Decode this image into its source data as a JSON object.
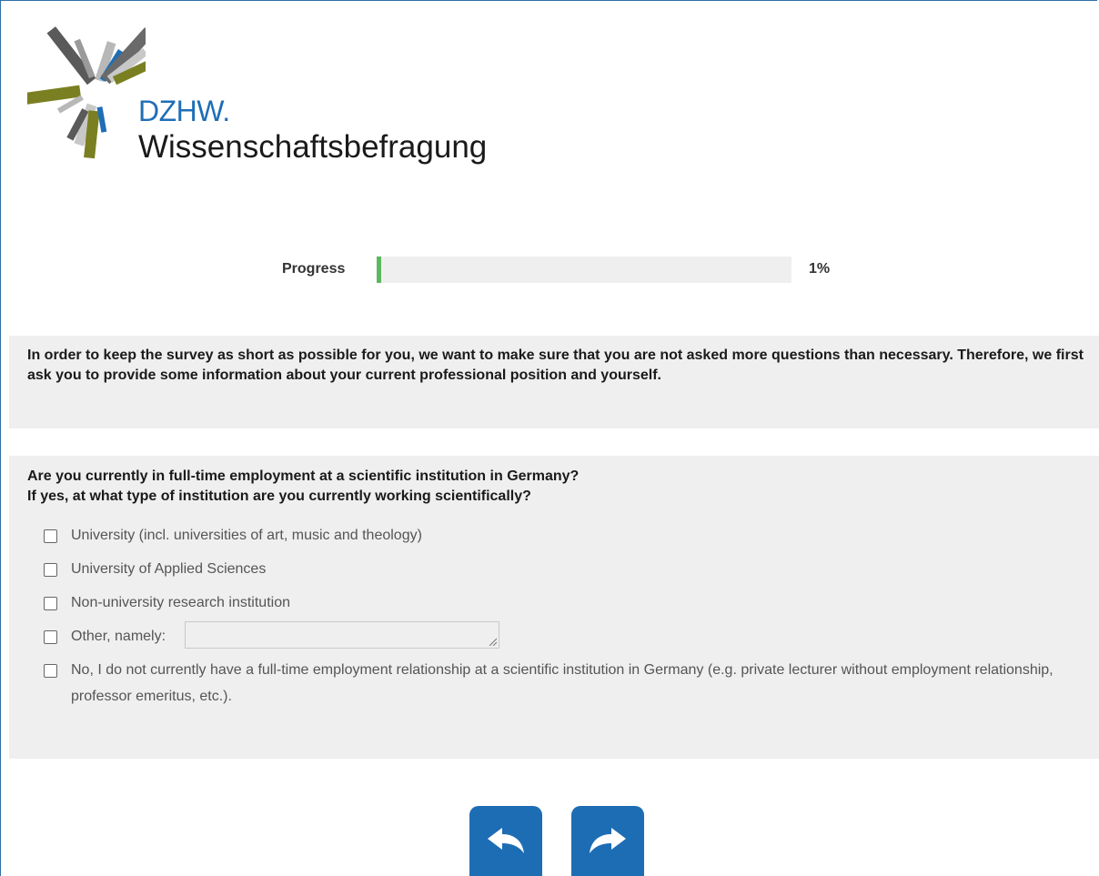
{
  "header": {
    "org_name": "DZHW.",
    "survey_name": "Wissenschaftsbefragung",
    "logo_icon": "dzhw-logo-rays"
  },
  "progress": {
    "label": "Progress",
    "percent_text": "1%",
    "value": 0.01,
    "fill_color": "#5cb85c"
  },
  "intro": {
    "text": "In order to keep the survey as short as possible for you, we want to make sure that you are not asked more questions than necessary. Therefore, we first ask you to provide some information about your current professional position and yourself."
  },
  "question": {
    "line1": "Are you currently in full-time employment at a scientific institution in Germany?",
    "line2": "If yes, at what type of institution are you currently working scientifically?",
    "options": [
      {
        "label": "University (incl. universities of art, music and theology)",
        "checked": false
      },
      {
        "label": "University of Applied Sciences",
        "checked": false
      },
      {
        "label": "Non-university research institution",
        "checked": false
      },
      {
        "label": "Other, namely:",
        "checked": false,
        "input_value": ""
      },
      {
        "label": "No, I do not currently have a full-time employment relationship at a scientific institution in Germany (e.g. private lecturer without employment relationship, professor emeritus, etc.).",
        "checked": false
      }
    ]
  },
  "navigation": {
    "back_icon": "back-arrow-icon",
    "next_icon": "forward-arrow-icon",
    "button_color": "#1d6db5"
  }
}
